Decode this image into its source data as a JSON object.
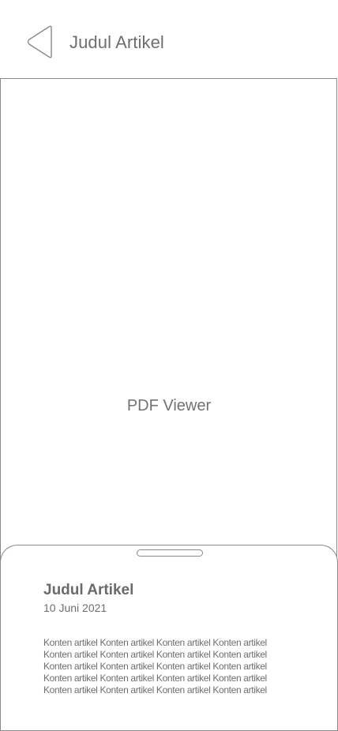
{
  "header": {
    "title": "Judul Artikel",
    "back_icon": "chevron-left-icon"
  },
  "viewer": {
    "label": "PDF Viewer"
  },
  "sheet": {
    "title": "Judul Artikel",
    "date": "10 Juni 2021",
    "content_lines": [
      "Konten artikel Konten artikel Konten artikel Konten artikel",
      "Konten artikel Konten artikel Konten artikel Konten artikel",
      "Konten artikel Konten artikel Konten artikel Konten artikel",
      "Konten artikel Konten artikel Konten artikel Konten artikel",
      "Konten artikel Konten artikel Konten artikel Konten artikel"
    ]
  },
  "colors": {
    "stroke": "#8a8a8a",
    "text": "#6e6e6e",
    "background": "#ffffff"
  }
}
